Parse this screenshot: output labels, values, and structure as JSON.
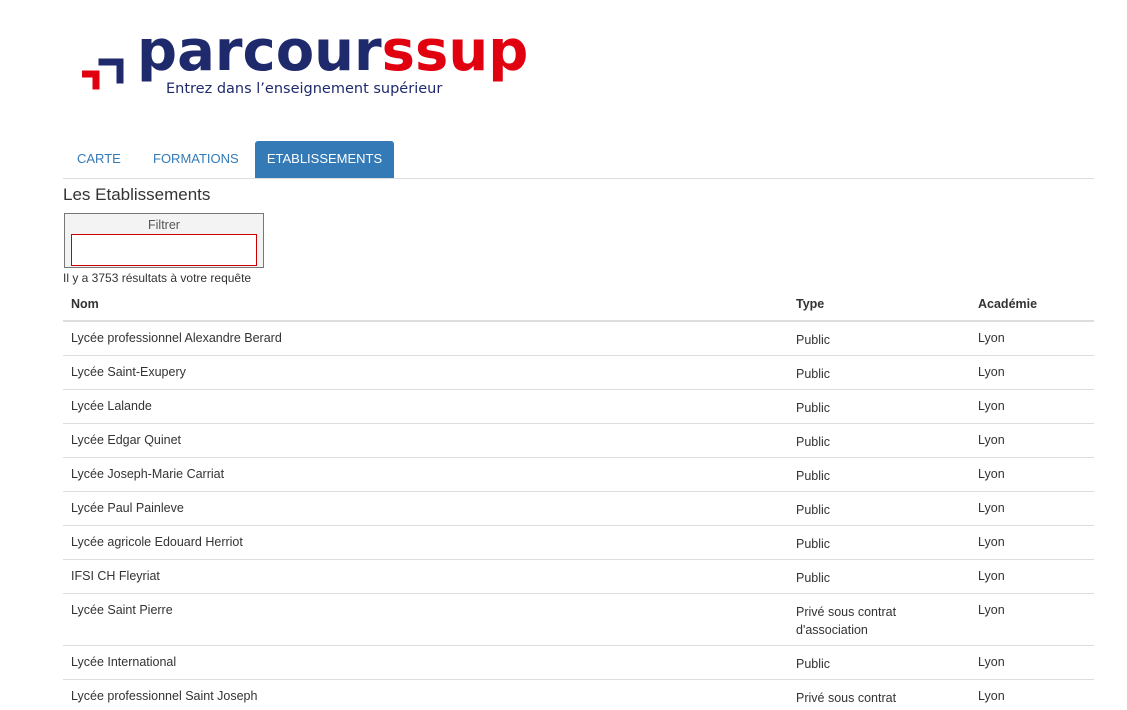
{
  "brand": {
    "name_part1": "parcour",
    "name_part2": "sup",
    "name_s": "s",
    "tagline": "Entrez dans l’enseignement supérieur",
    "colors": {
      "navy": "#1f2a6d",
      "red": "#e1000f",
      "tab_active": "#337ab7"
    }
  },
  "tabs": [
    {
      "label": "CARTE",
      "active": false
    },
    {
      "label": "FORMATIONS",
      "active": false
    },
    {
      "label": "ETABLISSEMENTS",
      "active": true
    }
  ],
  "section_title": "Les Etablissements",
  "filter": {
    "label": "Filtrer",
    "value": "",
    "placeholder": ""
  },
  "result_count": "Il y a 3753 résultats à votre requête",
  "table": {
    "headers": {
      "nom": "Nom",
      "type": "Type",
      "academie": "Académie"
    },
    "rows": [
      {
        "nom": "Lycée professionnel Alexandre Berard",
        "type": "Public",
        "academie": "Lyon"
      },
      {
        "nom": "Lycée Saint-Exupery",
        "type": "Public",
        "academie": "Lyon"
      },
      {
        "nom": "Lycée Lalande",
        "type": "Public",
        "academie": "Lyon"
      },
      {
        "nom": "Lycée Edgar Quinet",
        "type": "Public",
        "academie": "Lyon"
      },
      {
        "nom": "Lycée Joseph-Marie Carriat",
        "type": "Public",
        "academie": "Lyon"
      },
      {
        "nom": "Lycée Paul Painleve",
        "type": "Public",
        "academie": "Lyon"
      },
      {
        "nom": "Lycée agricole Edouard Herriot",
        "type": "Public",
        "academie": "Lyon"
      },
      {
        "nom": "IFSI CH Fleyriat",
        "type": "Public",
        "academie": "Lyon"
      },
      {
        "nom": "Lycée Saint Pierre",
        "type": "Privé sous contrat d'association",
        "academie": "Lyon"
      },
      {
        "nom": "Lycée International",
        "type": "Public",
        "academie": "Lyon"
      },
      {
        "nom": "Lycée professionnel Saint Joseph",
        "type": "Privé sous contrat d'association",
        "academie": "Lyon"
      }
    ]
  }
}
